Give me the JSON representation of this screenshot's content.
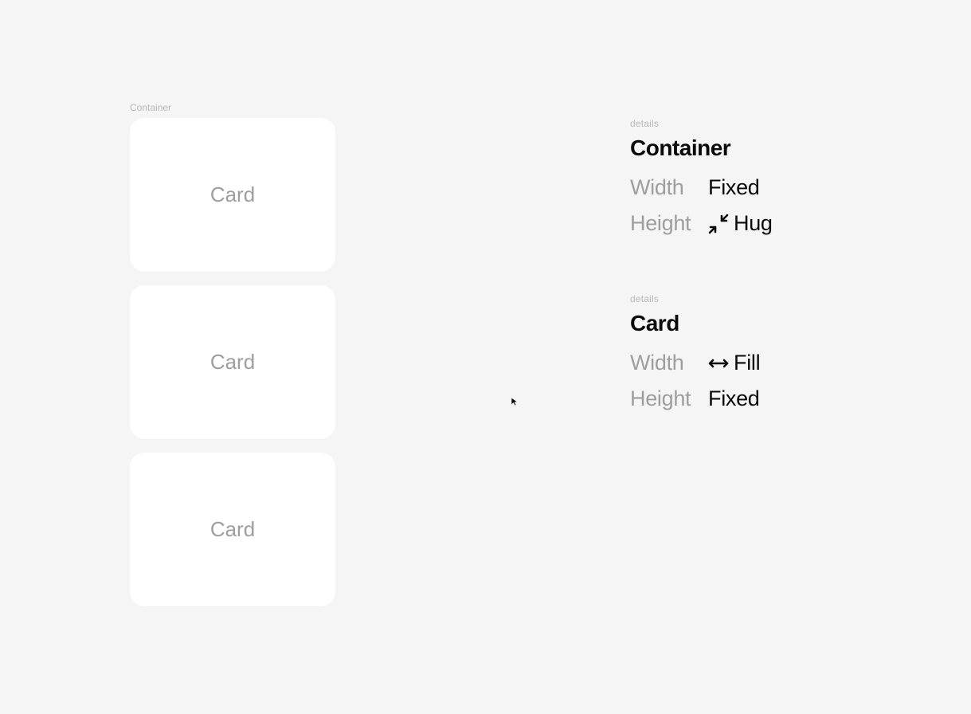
{
  "canvas": {
    "container_label": "Container",
    "cards": [
      {
        "label": "Card"
      },
      {
        "label": "Card"
      },
      {
        "label": "Card"
      }
    ]
  },
  "details": [
    {
      "section_label": "details",
      "title": "Container",
      "properties": [
        {
          "label": "Width",
          "value": "Fixed",
          "icon": null
        },
        {
          "label": "Height",
          "value": "Hug",
          "icon": "hug"
        }
      ]
    },
    {
      "section_label": "details",
      "title": "Card",
      "properties": [
        {
          "label": "Width",
          "value": "Fill",
          "icon": "fill"
        },
        {
          "label": "Height",
          "value": "Fixed",
          "icon": null
        }
      ]
    }
  ]
}
